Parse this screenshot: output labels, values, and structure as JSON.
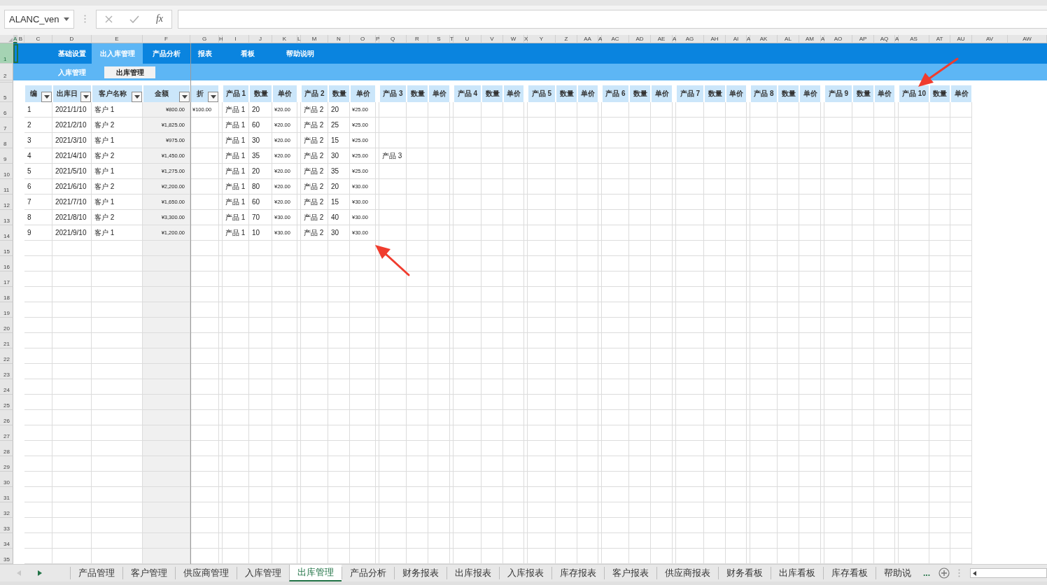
{
  "name_box": {
    "value": "ALANC_ven"
  },
  "formula_bar": {
    "fx": "fx"
  },
  "column_headers": [
    {
      "label": "A",
      "selected": true
    },
    {
      "label": "B",
      "selected": false
    },
    {
      "label": "C",
      "selected": false
    },
    {
      "label": "D",
      "selected": false
    },
    {
      "label": "E",
      "selected": false
    },
    {
      "label": "F",
      "selected": false
    },
    {
      "label": "G",
      "selected": false
    },
    {
      "label": "H",
      "selected": false
    },
    {
      "label": "I",
      "selected": false
    },
    {
      "label": "J",
      "selected": false
    },
    {
      "label": "K",
      "selected": false
    },
    {
      "label": "L",
      "selected": false
    },
    {
      "label": "M",
      "selected": false
    },
    {
      "label": "N",
      "selected": false
    },
    {
      "label": "O",
      "selected": false
    },
    {
      "label": "P",
      "selected": false
    },
    {
      "label": "Q",
      "selected": false
    },
    {
      "label": "R",
      "selected": false
    },
    {
      "label": "S",
      "selected": false
    },
    {
      "label": "T",
      "selected": false
    },
    {
      "label": "U",
      "selected": false
    },
    {
      "label": "V",
      "selected": false
    },
    {
      "label": "W",
      "selected": false
    },
    {
      "label": "X",
      "selected": false
    },
    {
      "label": "Y",
      "selected": false
    },
    {
      "label": "Z",
      "selected": false
    },
    {
      "label": "AA",
      "selected": false
    },
    {
      "label": "A",
      "selected": false
    },
    {
      "label": "AC",
      "selected": false
    },
    {
      "label": "AD",
      "selected": false
    },
    {
      "label": "AE",
      "selected": false
    },
    {
      "label": "A",
      "selected": false
    },
    {
      "label": "AG",
      "selected": false
    },
    {
      "label": "AH",
      "selected": false
    },
    {
      "label": "AI",
      "selected": false
    },
    {
      "label": "A",
      "selected": false
    },
    {
      "label": "AK",
      "selected": false
    },
    {
      "label": "AL",
      "selected": false
    },
    {
      "label": "AM",
      "selected": false
    },
    {
      "label": "A",
      "selected": false
    },
    {
      "label": "AO",
      "selected": false
    },
    {
      "label": "AP",
      "selected": false
    },
    {
      "label": "AQ",
      "selected": false
    },
    {
      "label": "A",
      "selected": false
    },
    {
      "label": "AS",
      "selected": false
    },
    {
      "label": "AT",
      "selected": false
    },
    {
      "label": "AU",
      "selected": false
    },
    {
      "label": "AV",
      "selected": false
    },
    {
      "label": "AW",
      "selected": false
    }
  ],
  "row_headers": [
    {
      "label": "1",
      "selected": true
    },
    {
      "label": "2",
      "selected": false
    },
    {
      "label": "5",
      "selected": false
    },
    {
      "label": "6",
      "selected": false
    },
    {
      "label": "7",
      "selected": false
    },
    {
      "label": "8",
      "selected": false
    },
    {
      "label": "9",
      "selected": false
    },
    {
      "label": "10",
      "selected": false
    },
    {
      "label": "11",
      "selected": false
    },
    {
      "label": "12",
      "selected": false
    },
    {
      "label": "13",
      "selected": false
    },
    {
      "label": "14",
      "selected": false
    },
    {
      "label": "15",
      "selected": false
    },
    {
      "label": "16",
      "selected": false
    },
    {
      "label": "17",
      "selected": false
    },
    {
      "label": "18",
      "selected": false
    },
    {
      "label": "19",
      "selected": false
    },
    {
      "label": "20",
      "selected": false
    },
    {
      "label": "21",
      "selected": false
    },
    {
      "label": "22",
      "selected": false
    },
    {
      "label": "23",
      "selected": false
    },
    {
      "label": "24",
      "selected": false
    },
    {
      "label": "25",
      "selected": false
    },
    {
      "label": "26",
      "selected": false
    },
    {
      "label": "27",
      "selected": false
    },
    {
      "label": "28",
      "selected": false
    },
    {
      "label": "29",
      "selected": false
    },
    {
      "label": "30",
      "selected": false
    },
    {
      "label": "31",
      "selected": false
    },
    {
      "label": "32",
      "selected": false
    },
    {
      "label": "33",
      "selected": false
    },
    {
      "label": "34",
      "selected": false
    },
    {
      "label": "35",
      "selected": false
    }
  ],
  "nav": {
    "items": [
      {
        "label": "基础设置",
        "selected": false
      },
      {
        "label": "出入库管理",
        "selected": true
      },
      {
        "label": "产品分析",
        "selected": false
      },
      {
        "label": "报表",
        "selected": false
      },
      {
        "label": "看板",
        "selected": false
      },
      {
        "label": "帮助说明",
        "selected": false
      }
    ]
  },
  "sub_nav": {
    "items": [
      {
        "label": "入库管理",
        "selected": false
      },
      {
        "label": "出库管理",
        "selected": true
      }
    ]
  },
  "table": {
    "headers": [
      {
        "label": "编",
        "filter": true
      },
      {
        "label": "出库日",
        "filter": true
      },
      {
        "label": "客户名称",
        "filter": true
      },
      {
        "label": "金额",
        "filter": true
      },
      {
        "label": "折",
        "filter": true
      }
    ],
    "product_groups": [
      {
        "product": "产品 1",
        "qty": "数量",
        "price": "单价"
      },
      {
        "product": "产品 2",
        "qty": "数量",
        "price": "单价"
      },
      {
        "product": "产品 3",
        "qty": "数量",
        "price": "单价"
      },
      {
        "product": "产品 4",
        "qty": "数量",
        "price": "单价"
      },
      {
        "product": "产品 5",
        "qty": "数量",
        "price": "单价"
      },
      {
        "product": "产品 6",
        "qty": "数量",
        "price": "单价"
      },
      {
        "product": "产品 7",
        "qty": "数量",
        "price": "单价"
      },
      {
        "product": "产品 8",
        "qty": "数量",
        "price": "单价"
      },
      {
        "product": "产品 9",
        "qty": "数量",
        "price": "单价"
      },
      {
        "product": "产品 10",
        "qty": "数量",
        "price": "单价"
      }
    ],
    "rows": [
      {
        "no": "1",
        "date": "2021/1/10",
        "customer": "客户 1",
        "amount": "¥800.00",
        "discount": "¥100.00",
        "items": [
          {
            "product": "产品 1",
            "qty": "20",
            "price": "¥20.00"
          },
          {
            "product": "产品 2",
            "qty": "20",
            "price": "¥25.00"
          }
        ]
      },
      {
        "no": "2",
        "date": "2021/2/10",
        "customer": "客户 2",
        "amount": "¥1,825.00",
        "items": [
          {
            "product": "产品 1",
            "qty": "60",
            "price": "¥20.00"
          },
          {
            "product": "产品 2",
            "qty": "25",
            "price": "¥25.00"
          }
        ]
      },
      {
        "no": "3",
        "date": "2021/3/10",
        "customer": "客户 1",
        "amount": "¥975.00",
        "items": [
          {
            "product": "产品 1",
            "qty": "30",
            "price": "¥20.00"
          },
          {
            "product": "产品 2",
            "qty": "15",
            "price": "¥25.00"
          }
        ]
      },
      {
        "no": "4",
        "date": "2021/4/10",
        "customer": "客户 2",
        "amount": "¥1,450.00",
        "items": [
          {
            "product": "产品 1",
            "qty": "35",
            "price": "¥20.00"
          },
          {
            "product": "产品 2",
            "qty": "30",
            "price": "¥25.00"
          },
          {
            "product": "产品 3"
          }
        ]
      },
      {
        "no": "5",
        "date": "2021/5/10",
        "customer": "客户 1",
        "amount": "¥1,275.00",
        "items": [
          {
            "product": "产品 1",
            "qty": "20",
            "price": "¥20.00"
          },
          {
            "product": "产品 2",
            "qty": "35",
            "price": "¥25.00"
          }
        ]
      },
      {
        "no": "6",
        "date": "2021/6/10",
        "customer": "客户 2",
        "amount": "¥2,200.00",
        "items": [
          {
            "product": "产品 1",
            "qty": "80",
            "price": "¥20.00"
          },
          {
            "product": "产品 2",
            "qty": "20",
            "price": "¥30.00"
          }
        ]
      },
      {
        "no": "7",
        "date": "2021/7/10",
        "customer": "客户 1",
        "amount": "¥1,650.00",
        "items": [
          {
            "product": "产品 1",
            "qty": "60",
            "price": "¥20.00"
          },
          {
            "product": "产品 2",
            "qty": "15",
            "price": "¥30.00"
          }
        ]
      },
      {
        "no": "8",
        "date": "2021/8/10",
        "customer": "客户 2",
        "amount": "¥3,300.00",
        "items": [
          {
            "product": "产品 1",
            "qty": "70",
            "price": "¥30.00"
          },
          {
            "product": "产品 2",
            "qty": "40",
            "price": "¥30.00"
          }
        ]
      },
      {
        "no": "9",
        "date": "2021/9/10",
        "customer": "客户 1",
        "amount": "¥1,200.00",
        "items": [
          {
            "product": "产品 1",
            "qty": "10",
            "price": "¥30.00"
          },
          {
            "product": "产品 2",
            "qty": "30",
            "price": "¥30.00"
          }
        ]
      }
    ]
  },
  "sheet_tabs": [
    {
      "label": "产品管理",
      "selected": false
    },
    {
      "label": "客户管理",
      "selected": false
    },
    {
      "label": "供应商管理",
      "selected": false
    },
    {
      "label": "入库管理",
      "selected": false
    },
    {
      "label": "出库管理",
      "selected": true
    },
    {
      "label": "产品分析",
      "selected": false
    },
    {
      "label": "财务报表",
      "selected": false
    },
    {
      "label": "出库报表",
      "selected": false
    },
    {
      "label": "入库报表",
      "selected": false
    },
    {
      "label": "库存报表",
      "selected": false
    },
    {
      "label": "客户报表",
      "selected": false
    },
    {
      "label": "供应商报表",
      "selected": false
    },
    {
      "label": "财务看板",
      "selected": false
    },
    {
      "label": "出库看板",
      "selected": false
    },
    {
      "label": "库存看板",
      "selected": false
    },
    {
      "label": "帮助说",
      "selected": false
    }
  ],
  "tab_overflow": "..."
}
